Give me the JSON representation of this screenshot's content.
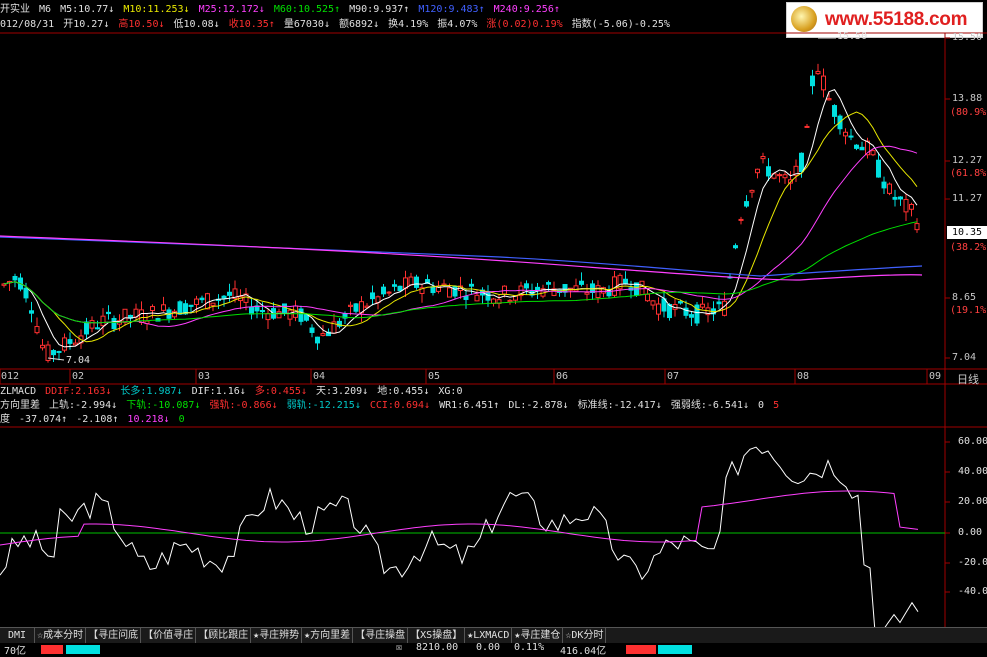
{
  "stock_title": "开实业",
  "ma_header": {
    "label": "M6",
    "m5": "M5:10.77↓",
    "m10": "M10:11.253↓",
    "m25": "M25:12.172↓",
    "m60": "M60:10.525↑",
    "m90": "M90:9.937↑",
    "m120": "M120:9.483↑",
    "m240": "M240:9.256↑"
  },
  "quote_line": {
    "date": "012/08/31",
    "open": "开10.27↓",
    "high": "高10.50↓",
    "low": "低10.08↓",
    "close": "收10.35↑",
    "volume": "量67030↓",
    "amount": "额6892↓",
    "turnover": "换4.19%",
    "amplitude": "振4.07%",
    "change": "涨(0.02)0.19%",
    "index": "指数(-5.06)-0.25%"
  },
  "logo": {
    "text": "www.55188.com"
  },
  "price_axis": {
    "ticks": [
      "15.50",
      "13.88",
      "12.27",
      "11.27",
      "8.65",
      "7.04"
    ],
    "pct_ticks": [
      "(80.9%)",
      "(61.8%)",
      "(38.2%)",
      "(19.1%)"
    ],
    "current": "10.35"
  },
  "annotations": {
    "high": "15.50",
    "low": "7.04"
  },
  "date_axis": {
    "labels": [
      "012",
      "02",
      "03",
      "04",
      "05",
      "06",
      "07",
      "08",
      "09"
    ],
    "period": "日线"
  },
  "indicator_line_1": {
    "name": "ZLMACD",
    "ddif": "DDIF:2.163↓",
    "long_short": "长多:1.987↓",
    "dif": "DIF:1.16↓",
    "duo": "多:0.455↓",
    "tian": "天:3.209↓",
    "di": "地:0.455↓",
    "xg": "XG:0"
  },
  "indicator_line_2": {
    "name": "方向里差",
    "upper": "上轨:-2.994↓",
    "lower": "下轨:-10.087↓",
    "strong": "强轨:-0.866↓",
    "weak": "弱轨:-12.215↓",
    "cci": "CCI:0.694↓",
    "wr1": "WR1:6.451↑",
    "dl": "DL:-2.878↓",
    "standard": "标准线:-12.417↓",
    "strength": "强弱线:-6.541↓",
    "zero": "0",
    "five": "5"
  },
  "indicator_line_3": {
    "name": "度",
    "v1": "-37.074↑",
    "v2": "-2.108↑",
    "v3": "10.218↓",
    "v4": "0"
  },
  "osc_axis": {
    "ticks": [
      "60.00",
      "40.00",
      "20.00",
      "0.00",
      "-20.00",
      "-40.00"
    ]
  },
  "tabs": [
    "DMI",
    "☆成本分时",
    "【寻庄问底",
    "【价值寻庄",
    "【顾比跟庄",
    "★寻庄辨势",
    "★方向里差",
    "【寻庄操盘",
    "【XS操盘】",
    "★LXMACD",
    "★寻庄建仓",
    "☆DK分时"
  ],
  "status_bar": {
    "left": "70亿",
    "index": "8210.00",
    "change": "0.00",
    "pct": "0.11%",
    "amount": "416.04亿"
  },
  "colors": {
    "up": "#ff3030",
    "down": "#00e0e0",
    "ma5": "#ffffff",
    "ma10": "#e8e800",
    "ma25": "#ff40ff",
    "ma60": "#00e000",
    "ma120": "#4060ff",
    "ma240": "#ff40ff"
  }
}
